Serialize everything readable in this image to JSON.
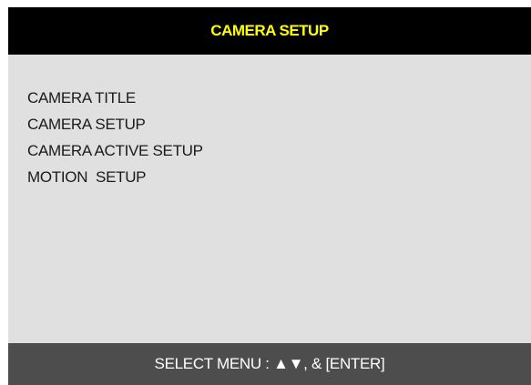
{
  "header": {
    "title": "CAMERA SETUP"
  },
  "menu": {
    "items": [
      {
        "label": "CAMERA TITLE"
      },
      {
        "label": "CAMERA SETUP"
      },
      {
        "label": "CAMERA ACTIVE SETUP"
      },
      {
        "label": "MOTION  SETUP"
      }
    ]
  },
  "footer": {
    "hint": "SELECT MENU : ▲▼, & [ENTER]"
  },
  "colors": {
    "header_bg": "#000000",
    "title_text": "#ffff00",
    "body_bg": "#e0e0e0",
    "footer_bg": "#4d4d4d",
    "footer_text": "#ffffff"
  }
}
